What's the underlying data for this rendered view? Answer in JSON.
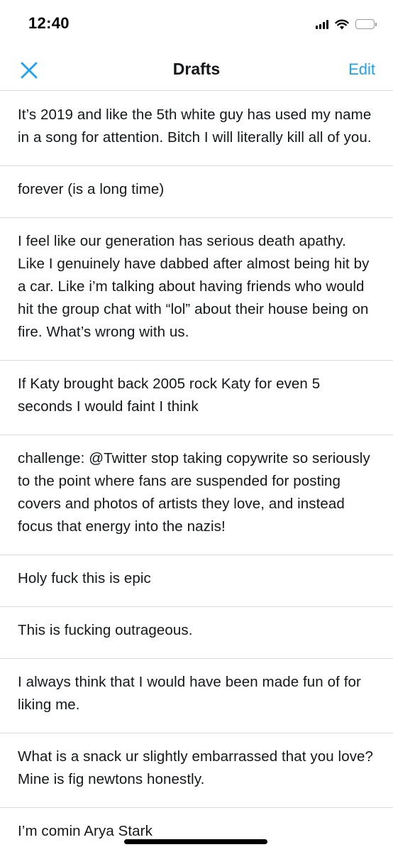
{
  "status_bar": {
    "time": "12:40",
    "icons": [
      "cellular-signal-icon",
      "wifi-icon",
      "battery-icon"
    ]
  },
  "nav": {
    "close_icon": "close-icon",
    "title": "Drafts",
    "edit_label": "Edit"
  },
  "colors": {
    "accent": "#1da1f2",
    "text": "#14171a",
    "divider": "#dcdcdc"
  },
  "drafts": [
    {
      "text": "It’s 2019 and like the 5th white guy has used my name in a song for attention. Bitch I will literally kill all of you."
    },
    {
      "text": "forever (is a long time)"
    },
    {
      "text": "I feel like our generation has serious death apathy. Like I genuinely have dabbed after almost being hit by a car. Like i’m talking about having friends who would hit the group chat with “lol” about their house being on fire. What’s wrong with us."
    },
    {
      "text": "If Katy brought back 2005 rock Katy for even 5 seconds I would faint I think"
    },
    {
      "text": "challenge: @Twitter stop taking copywrite so seriously to the point where fans are suspended for posting covers and photos of artists they love, and instead focus that energy into the nazis!"
    },
    {
      "text": "Holy fuck this is epic"
    },
    {
      "text": "This is fucking outrageous."
    },
    {
      "text": "I always think that I would have been made fun of for liking me."
    },
    {
      "text": "What is a snack ur slightly embarrassed that you love? Mine is fig newtons honestly."
    },
    {
      "text": "I’m comin Arya Stark"
    }
  ]
}
